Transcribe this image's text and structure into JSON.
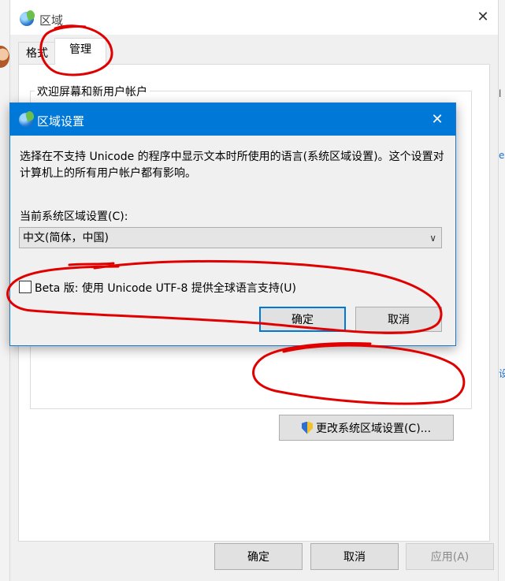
{
  "window": {
    "title": "区域",
    "close_symbol": "✕"
  },
  "tabs": [
    {
      "label": "格式"
    },
    {
      "label": "管理"
    }
  ],
  "panel": {
    "group_label": "欢迎屏幕和新用户帐户",
    "change_locale_button": "更改系统区域设置(C)..."
  },
  "footer": {
    "ok": "确定",
    "cancel": "取消",
    "apply": "应用(A)"
  },
  "dialog": {
    "title": "区域设置",
    "close_symbol": "✕",
    "description": "选择在不支持 Unicode 的程序中显示文本时所使用的语言(系统区域设置)。这个设置对计算机上的所有用户帐户都有影响。",
    "current_locale_label": "当前系统区域设置(C):",
    "current_locale_value": "中文(简体，中国)",
    "beta_checkbox_label": "Beta 版: 使用 Unicode UTF-8 提供全球语言支持(U)",
    "beta_checked": false,
    "ok": "确定",
    "cancel": "取消"
  },
  "edge_marks": {
    "right_top": "l",
    "right_mid": "e",
    "right_low": "设"
  },
  "colors": {
    "accent": "#0078d7",
    "annotation": "#e00000"
  },
  "icons": {
    "window": "globe-icon",
    "dialog": "globe-icon",
    "change_button": "uac-shield-icon",
    "select": "chevron-down-icon"
  }
}
